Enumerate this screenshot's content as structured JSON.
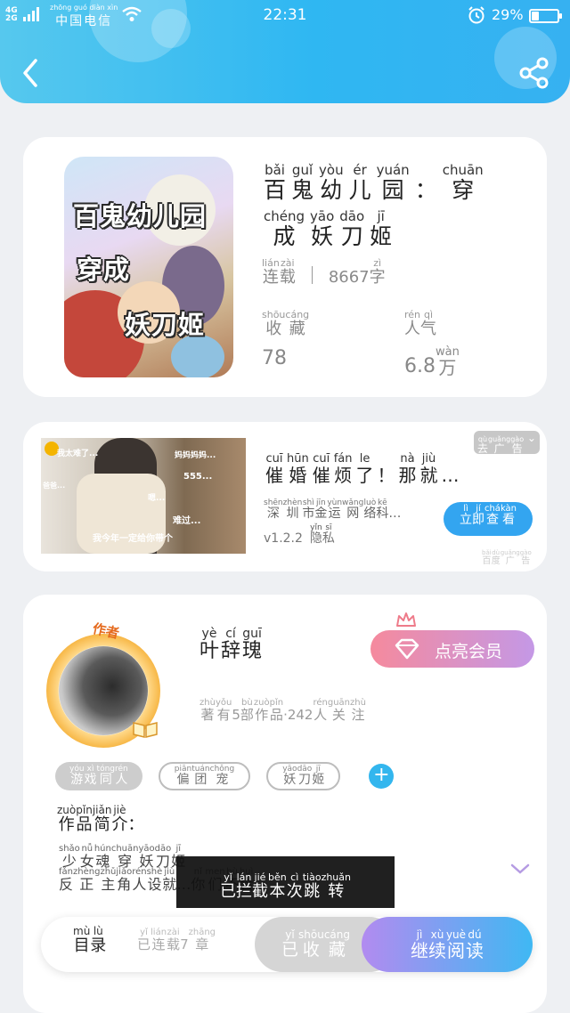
{
  "status_bar": {
    "signal": "4G\n2G",
    "carrier_pinyin": "zhōng guó diàn xìn",
    "carrier": "中国电信",
    "time": "22:31",
    "battery_pct": "29%",
    "battery_level": 0.29
  },
  "book": {
    "title_rows": [
      [
        [
          "bǎi",
          "百"
        ],
        [
          "guǐ",
          "鬼"
        ],
        [
          "yòu",
          "幼"
        ],
        [
          "ér",
          "儿"
        ],
        [
          "yuán",
          "园"
        ],
        [
          "",
          "："
        ],
        [
          "chuān",
          "穿"
        ]
      ],
      [
        [
          "chéng",
          "成"
        ],
        [
          "yāo",
          "妖"
        ],
        [
          "dāo",
          "刀"
        ],
        [
          "jī",
          "姬"
        ]
      ]
    ],
    "cover_lines": [
      "百鬼幼儿园",
      "穿成",
      "妖刀姬"
    ],
    "status": [
      [
        "lián",
        "连"
      ],
      [
        "zài",
        "载"
      ]
    ],
    "word_count": "8667",
    "word_unit": [
      [
        "zì",
        "字"
      ]
    ],
    "collect_label": [
      [
        "shōu",
        "收"
      ],
      [
        "cáng",
        "藏"
      ]
    ],
    "collect_value": "78",
    "popularity_label": [
      [
        "rén",
        "人"
      ],
      [
        "qì",
        "气"
      ]
    ],
    "popularity_value": "6.8",
    "popularity_unit": [
      [
        "wàn",
        "万"
      ]
    ]
  },
  "ad": {
    "tag": [
      [
        "qù",
        "去"
      ],
      [
        "guǎng",
        "广"
      ],
      [
        "gào",
        "告"
      ]
    ],
    "title": [
      [
        "cuī",
        "催"
      ],
      [
        "hūn",
        "婚"
      ],
      [
        "cuī",
        "催"
      ],
      [
        "fán",
        "烦"
      ],
      [
        "le",
        "了"
      ],
      [
        "",
        "！"
      ],
      [
        "nà",
        "那"
      ],
      [
        "jiù",
        "就"
      ],
      [
        "",
        "…"
      ]
    ],
    "company": [
      [
        "shēn",
        "深"
      ],
      [
        "zhèn",
        "圳"
      ],
      [
        "shì",
        "市"
      ],
      [
        "jīn",
        "金"
      ],
      [
        "yùn",
        "运"
      ],
      [
        "wǎng",
        "网"
      ],
      [
        "luò",
        "络"
      ],
      [
        "kē",
        "科"
      ],
      [
        "",
        "…"
      ]
    ],
    "version": "v1.2.2",
    "privacy": [
      [
        "yǐn",
        "隐"
      ],
      [
        "sī",
        "私"
      ]
    ],
    "button": [
      [
        "lì",
        "立"
      ],
      [
        "jí",
        "即"
      ],
      [
        "chá",
        "查"
      ],
      [
        "kàn",
        "看"
      ]
    ],
    "source": [
      [
        "bǎi",
        "百"
      ],
      [
        "dù",
        "度"
      ],
      [
        "guǎng",
        "广"
      ],
      [
        "gào",
        "告"
      ]
    ],
    "image_captions": [
      "我太难了...",
      "妈妈妈妈...",
      "555...",
      "爸爸...",
      "嗯...",
      "难过...",
      "我今年一定给你带个"
    ]
  },
  "author": {
    "badge": "作者",
    "name": [
      [
        "yè",
        "叶"
      ],
      [
        "cí",
        "辞"
      ],
      [
        "guī",
        "瑰"
      ]
    ],
    "stats": [
      [
        "zhù",
        "著"
      ],
      [
        "yǒu",
        "有"
      ],
      [
        "",
        "5"
      ],
      [
        "bù",
        "部"
      ],
      [
        "zuò",
        "作"
      ],
      [
        "pǐn",
        "品"
      ],
      [
        "",
        "·242"
      ],
      [
        "rén",
        "人"
      ],
      [
        "guān",
        "关"
      ],
      [
        "zhù",
        "注"
      ]
    ],
    "vip_label": "点亮会员",
    "tags": [
      {
        "style": "filled",
        "chars": [
          [
            "yóu",
            "游"
          ],
          [
            "xì",
            "戏"
          ],
          [
            "tóng",
            "同"
          ],
          [
            "rén",
            "人"
          ]
        ]
      },
      {
        "style": "outline",
        "chars": [
          [
            "piān",
            "偏"
          ],
          [
            "tuán",
            "团"
          ],
          [
            "chǒng",
            "宠"
          ]
        ]
      },
      {
        "style": "outline",
        "chars": [
          [
            "yāo",
            "妖"
          ],
          [
            "dāo",
            "刀"
          ],
          [
            "jī",
            "姬"
          ]
        ]
      }
    ],
    "intro_heading": [
      [
        "zuò",
        "作"
      ],
      [
        "pǐn",
        "品"
      ],
      [
        "jiǎn",
        "简"
      ],
      [
        "jiè",
        "介"
      ],
      [
        "",
        "："
      ]
    ],
    "intro_line1": [
      [
        "shǎo",
        "少"
      ],
      [
        "nǚ",
        "女"
      ],
      [
        "hún",
        "魂"
      ],
      [
        "chuān",
        "穿"
      ],
      [
        "yāo",
        "妖"
      ],
      [
        "dāo",
        "刀"
      ],
      [
        "jī",
        "姬"
      ]
    ],
    "intro_line2": [
      [
        "fǎn",
        "反"
      ],
      [
        "zhèng",
        "正"
      ],
      [
        "zhǔ",
        "主"
      ],
      [
        "jiǎo",
        "角"
      ],
      [
        "rén",
        "人"
      ],
      [
        "shè",
        "设"
      ],
      [
        "jiù",
        "就"
      ],
      [
        "",
        "…"
      ],
      [
        "nǐ",
        "你"
      ],
      [
        "men",
        "们"
      ],
      [
        "bù",
        "不"
      ],
      [
        "huì",
        "会"
      ],
      [
        "",
        "…"
      ]
    ]
  },
  "toast": [
    [
      "yǐ",
      "已"
    ],
    [
      "lán",
      "拦"
    ],
    [
      "jié",
      "截"
    ],
    [
      "běn",
      "本"
    ],
    [
      "cì",
      "次"
    ],
    [
      "tiào",
      "跳"
    ],
    [
      "zhuǎn",
      "转"
    ]
  ],
  "bottom": {
    "toc": [
      [
        "mù",
        "目"
      ],
      [
        "lù",
        "录"
      ]
    ],
    "chapters": [
      [
        "yǐ",
        "已"
      ],
      [
        "lián",
        "连"
      ],
      [
        "zài",
        "载"
      ],
      [
        "",
        "7"
      ],
      [
        "zhāng",
        "章"
      ]
    ],
    "collected": [
      [
        "yǐ",
        "已"
      ],
      [
        "shōu",
        "收"
      ],
      [
        "cáng",
        "藏"
      ]
    ],
    "continue": [
      [
        "jì",
        "继"
      ],
      [
        "xù",
        "续"
      ],
      [
        "yuè",
        "阅"
      ],
      [
        "dú",
        "读"
      ]
    ]
  },
  "colors": {
    "header_blue": "#2fb7f2",
    "accent_blue": "#33a5f0",
    "vip_pink": "#f58a9d",
    "vip_purple": "#c498e6"
  }
}
